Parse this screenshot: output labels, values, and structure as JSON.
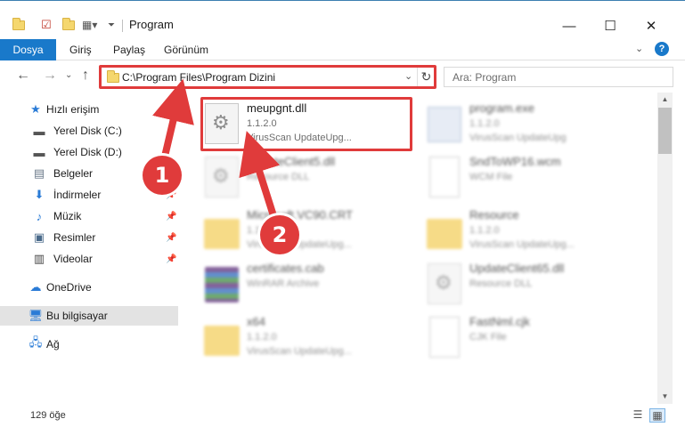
{
  "window": {
    "title": "Program",
    "minimize": "—",
    "maximize": "☐",
    "close": "✕"
  },
  "ribbon": {
    "tabs": [
      "Dosya",
      "Giriş",
      "Paylaş",
      "Görünüm"
    ],
    "help": "?"
  },
  "nav": {
    "address": "C:\\Program Files\\Program Dizini",
    "search_placeholder": "Ara: Program"
  },
  "sidebar": {
    "quick_access": "Hızlı erişim",
    "items": [
      {
        "label": "Yerel Disk (C:)",
        "icon": "drive-icon",
        "pinned": false
      },
      {
        "label": "Yerel Disk (D:)",
        "icon": "drive-icon",
        "pinned": false
      },
      {
        "label": "Belgeler",
        "icon": "documents-icon",
        "pinned": true
      },
      {
        "label": "İndirmeler",
        "icon": "download-icon",
        "pinned": true
      },
      {
        "label": "Müzik",
        "icon": "music-icon",
        "pinned": true
      },
      {
        "label": "Resimler",
        "icon": "pictures-icon",
        "pinned": true
      },
      {
        "label": "Videolar",
        "icon": "video-icon",
        "pinned": true
      }
    ],
    "onedrive": "OneDrive",
    "this_pc": "Bu bilgisayar",
    "network": "Ağ"
  },
  "files": [
    {
      "name": "meupgnt.dll",
      "line2": "1.1.2.0",
      "line3": "VirusScan UpdateUpg...",
      "type": "dll",
      "highlighted": true
    },
    {
      "name": "program.exe",
      "line2": "1.1.2.0",
      "line3": "VirusScan UpdateUpg",
      "type": "exe"
    },
    {
      "name": "UpdateClient5.dll",
      "line2": "Resource DLL",
      "line3": "",
      "type": "dll"
    },
    {
      "name": "SndToWP16.wcm",
      "line2": "WCM File",
      "line3": "",
      "type": "doc"
    },
    {
      "name": "Microsoft.VC90.CRT",
      "line2": "1.1.2.0",
      "line3": "VirusScan UpdateUpg...",
      "type": "folder"
    },
    {
      "name": "Resource",
      "line2": "1.1.2.0",
      "line3": "VirusScan UpdateUpg...",
      "type": "folder"
    },
    {
      "name": "certificates.cab",
      "line2": "WinRAR Archive",
      "line3": "",
      "type": "archive"
    },
    {
      "name": "UpdateClient65.dll",
      "line2": "Resource DLL",
      "line3": "",
      "type": "dll"
    },
    {
      "name": "x64",
      "line2": "1.1.2.0",
      "line3": "VirusScan UpdateUpg...",
      "type": "folder"
    },
    {
      "name": "FastNml.cjk",
      "line2": "CJK File",
      "line3": "",
      "type": "doc"
    }
  ],
  "status": {
    "count": "129 öğe"
  },
  "callouts": [
    "1",
    "2"
  ],
  "colors": {
    "accent": "#1979ca",
    "highlight": "#e03b3b"
  }
}
